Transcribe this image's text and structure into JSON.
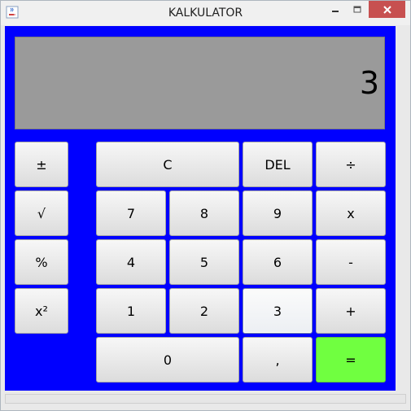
{
  "window": {
    "title": "KALKULATOR",
    "minimize_label": "‒",
    "maximize_label": "☐",
    "close_label": "✕",
    "icon": "java-cup-icon"
  },
  "display": {
    "value": "3"
  },
  "buttons": {
    "plus_minus": "±",
    "sqrt": "√",
    "percent": "%",
    "square": "x²",
    "clear": "C",
    "delete": "DEL",
    "divide": "÷",
    "seven": "7",
    "eight": "8",
    "nine": "9",
    "multiply": "x",
    "four": "4",
    "five": "5",
    "six": "6",
    "minus": "-",
    "one": "1",
    "two": "2",
    "three": "3",
    "plus": "+",
    "zero": "0",
    "comma": ",",
    "equals": "="
  },
  "colors": {
    "panel_background": "#0000ff",
    "display_background": "#9a9a9a",
    "equals_background": "#70ff40",
    "close_button": "#c75050"
  }
}
